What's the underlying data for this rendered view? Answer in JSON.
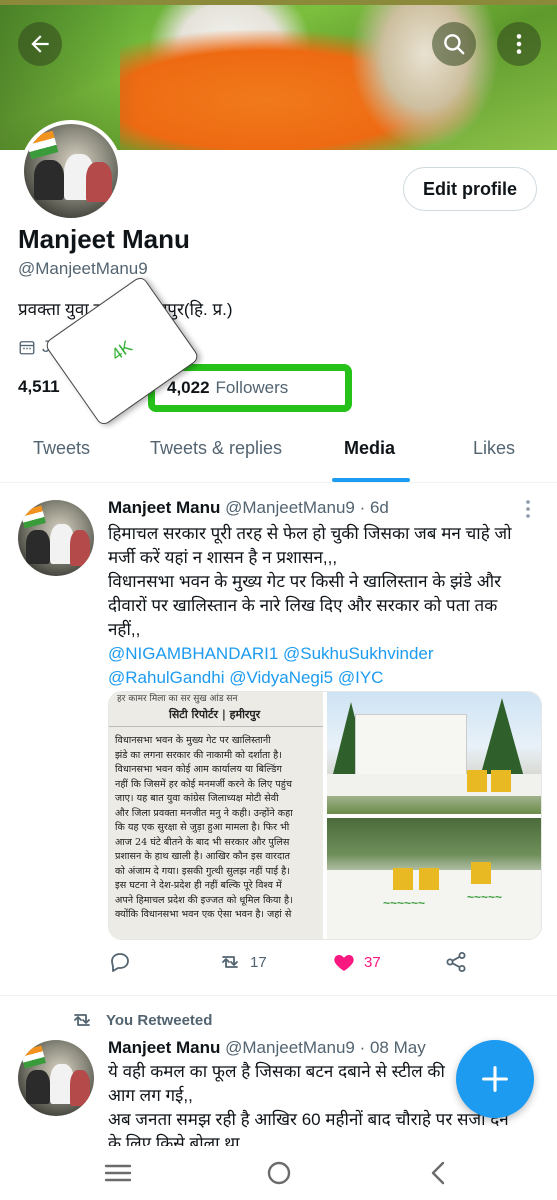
{
  "profile": {
    "name": "Manjeet Manu",
    "handle": "@ManjeetManu9",
    "bio": "प्रवक्ता युवा कांग्रेस हमीरपुर(हि. प्र.)",
    "joined_label": "Joi",
    "following_count": "4,511",
    "followers_count": "4,022",
    "followers_label": "Followers",
    "sticker_text": "4K",
    "edit_button": "Edit profile"
  },
  "tabs": [
    "Tweets",
    "Tweets & replies",
    "Media",
    "Likes"
  ],
  "active_tab": "Media",
  "tweets": [
    {
      "name": "Manjeet Manu",
      "meta": "@ManjeetManu9 · 6d",
      "lines": [
        "हिमाचल सरकार पूरी तरह से फेल हो चुकी जिसका जब मन चाहे जो",
        "मर्जी करें यहां न शासन है न प्रशासन,,,",
        "विधानसभा भवन के मुख्य गेट पर किसी ने खालिस्तान के झंडे और",
        "दीवारों पर खालिस्तान के नारे लिख दिए और सरकार को पता तक",
        "नहीं,,",
        "@NIGAMBHANDARI1 @SukhuSukhvinder",
        "@RahulGandhi @VidyaNegi5 @IYC"
      ],
      "media": {
        "news_header": "सिटी रिपोर्टर | हमीरपुर",
        "news_top": "हर कामर मिला का सर सुख आंड सन",
        "news_lines": [
          "विधानसभा भवन के मुख्य गेट पर खालिस्तानी",
          "झंडे का लगना सरकार की नाकामी को दर्शाता है।",
          "विधानसभा भवन कोई आम कार्यालय या बिल्डिंग",
          "नहीं कि जिसमें हर कोई मनमर्जी करने के लिए पहुंच",
          "जाए। यह बात युवा कांग्रेस जिलाध्यक्ष मोटी सेवी",
          "और जिला प्रवक्ता मनजीत मनु ने कही। उन्होंने कहा",
          "कि यह एक सुरक्षा से जुड़ा हुआ मामला है। फिर भी",
          "आज 24 घंटे बीतने के बाद भी सरकार और पुलिस",
          "प्रशासन के हाथ खाली है। आखिर कौन इस वारदात",
          "को अंजाम दे गया। इसकी गुत्थी सुलझ नहीं पाई है।",
          "इस घटना ने देश-प्रदेश ही नहीं बल्कि पूरे विश्व में",
          "अपने हिमाचल प्रदेश की इज्जत को धूमिल किया है।",
          "क्योंकि विधानसभा भवन एक ऐसा भवन है। जहां से"
        ]
      },
      "retweets": "17",
      "likes": "37"
    },
    {
      "retweeted_label": "You Retweeted",
      "name": "Manjeet Manu",
      "meta": "@ManjeetManu9 · 08 May",
      "lines": [
        "ये वही कमल का फूल है जिसका बटन दबाने से स्टील की",
        "आग लग गई,,",
        "अब जनता समझ रही है आखिर 60 महीनों बाद चौराहे पर सजा देने",
        "के लिए किसे बोला था"
      ]
    }
  ],
  "colors": {
    "accent": "#1d9bf0",
    "like": "#f91880",
    "highlight_box": "#26c21a"
  }
}
